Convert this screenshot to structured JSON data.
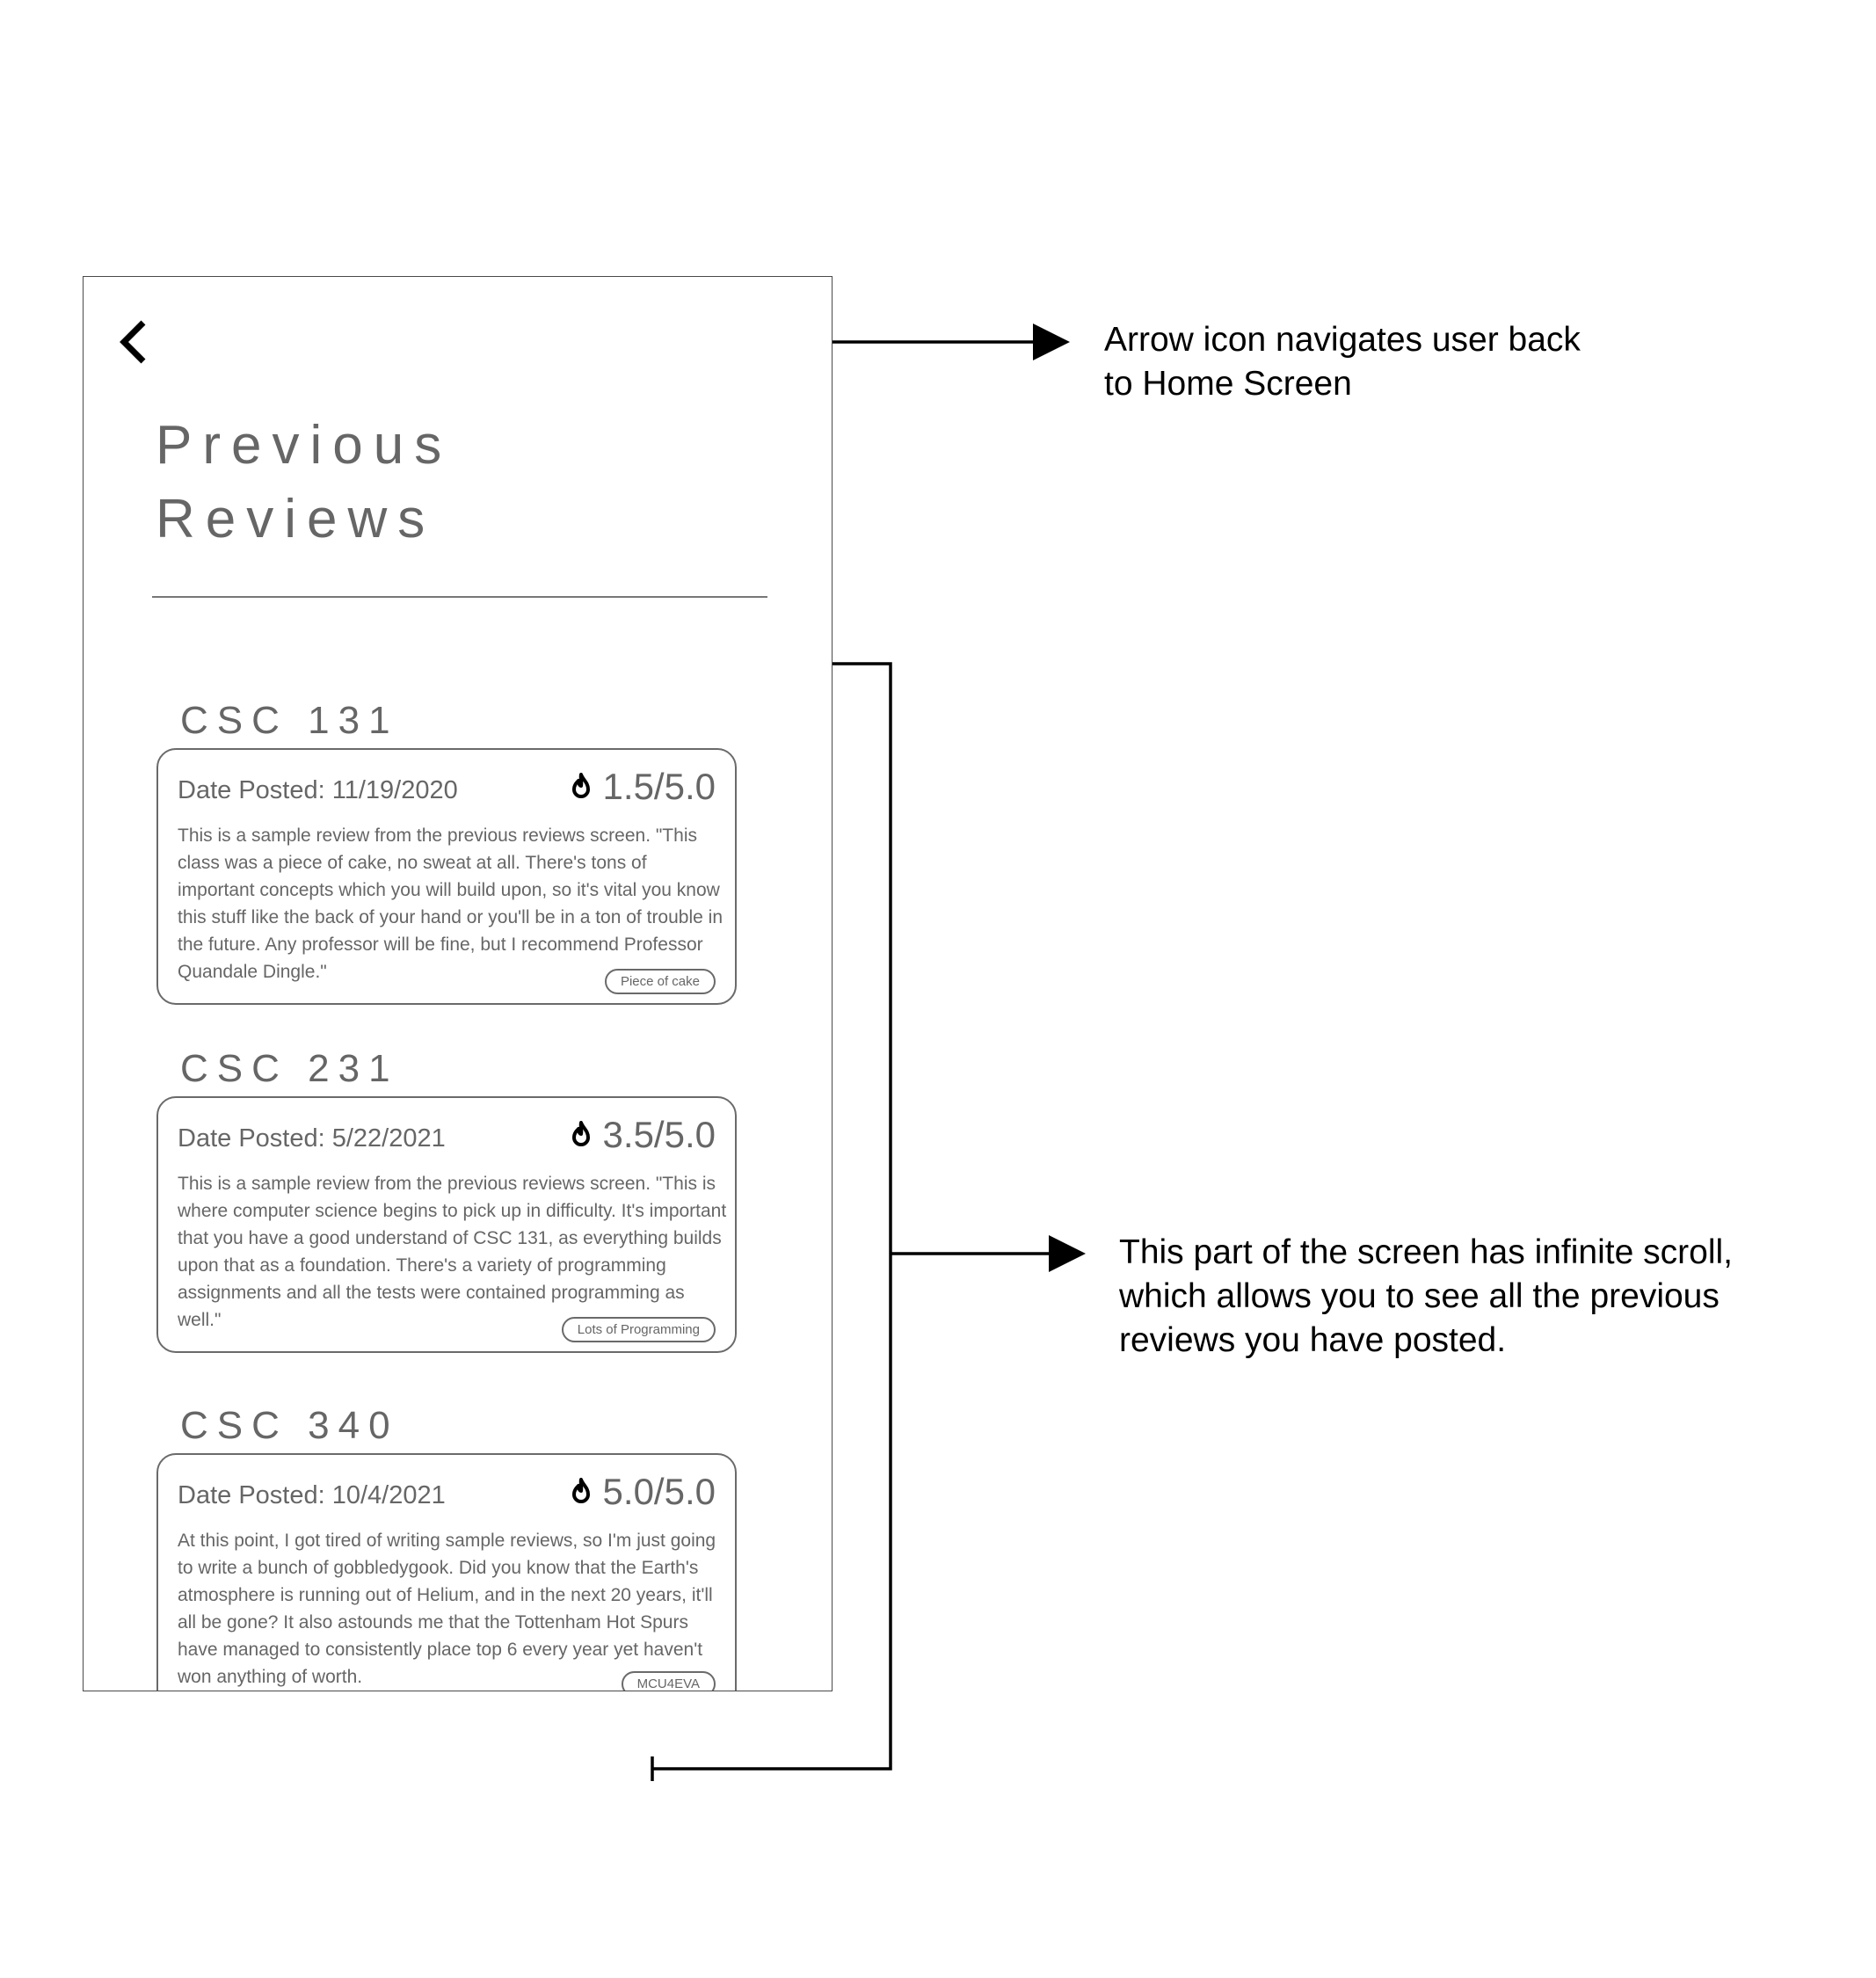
{
  "screen": {
    "back_icon": "chevron-left-icon",
    "title_line1": "Previous",
    "title_line2": "Reviews"
  },
  "reviews": [
    {
      "course": "CSC 131",
      "date": "Date Posted: 11/19/2020",
      "rating": "1.5/5.0",
      "icon": "flame-icon",
      "text": "This is a sample review from the previous reviews screen. \"This class was a piece of cake, no sweat at all. There's tons of important concepts which you will build upon, so it's vital you know this stuff like the back of your hand or you'll be in a ton of trouble in the future. Any professor will be fine, but I recommend Professor Quandale Dingle.\"",
      "tag": "Piece of cake"
    },
    {
      "course": "CSC 231",
      "date": "Date Posted: 5/22/2021",
      "rating": "3.5/5.0",
      "icon": "flame-icon",
      "text": "This is a sample review from the previous reviews screen. \"This is where computer science begins to pick up in difficulty. It's important that you have a good understand of CSC 131, as everything builds upon that as a foundation. There's a variety of programming assignments and all the tests were contained programming as well.\"",
      "tag": "Lots of Programming"
    },
    {
      "course": "CSC 340",
      "date": "Date Posted: 10/4/2021",
      "rating": "5.0/5.0",
      "icon": "flame-icon",
      "text": "At this point, I got tired of writing sample reviews, so I'm just going to write a bunch of gobbledygook. Did you know that the Earth's atmosphere is running out of Helium, and in the next 20 years, it'll all be gone?  It also astounds me that the Tottenham Hot Spurs have managed to consistently place top 6 every year yet haven't won anything of worth.",
      "tag": "MCU4EVA"
    }
  ],
  "annotations": {
    "arrow_note": "Arrow icon navigates user back to Home Screen",
    "scroll_note": "This part of the screen has infinite scroll, which allows you to see all the previous reviews you have posted."
  },
  "colors": {
    "ui_text": "#666666",
    "border": "#6a6a6a",
    "annotation": "#000000"
  }
}
